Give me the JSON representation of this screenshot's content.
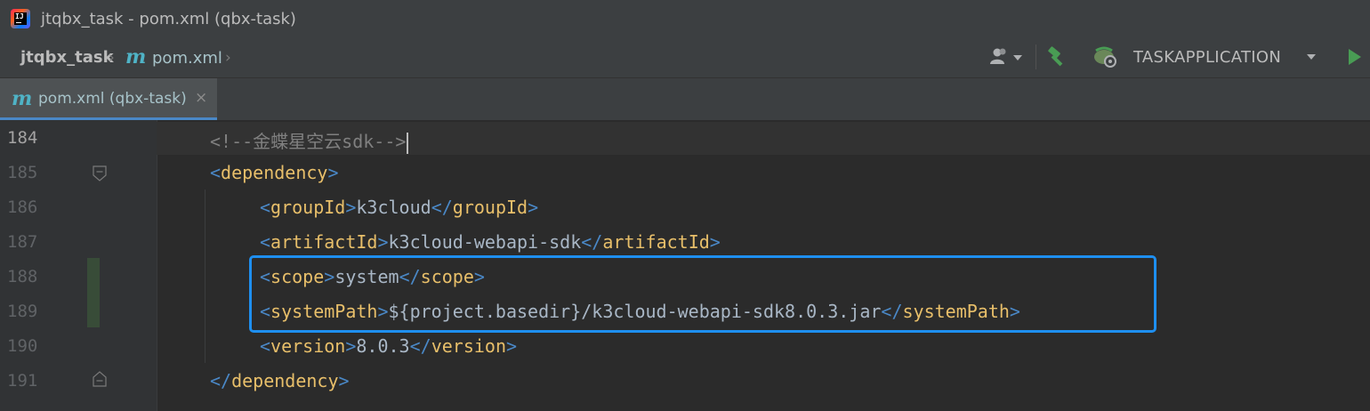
{
  "window": {
    "title": "jtqbx_task - pom.xml (qbx-task)",
    "app_icon_text": "IJ"
  },
  "navbar": {
    "project": "jtqbx_task",
    "file": "pom.xml",
    "run_configuration": "TASKAPPLICATION",
    "file_icon": "maven-m-icon"
  },
  "tab": {
    "label": "pom.xml (qbx-task)",
    "close": "×"
  },
  "editor": {
    "lines": [
      {
        "num": "184",
        "segments": [
          "<!--",
          "金蝶星空云sdk",
          "-->"
        ]
      },
      {
        "num": "185",
        "tag": "dependency",
        "kind": "open"
      },
      {
        "num": "186",
        "tag": "groupId",
        "value": "k3cloud"
      },
      {
        "num": "187",
        "tag": "artifactId",
        "value": "k3cloud-webapi-sdk"
      },
      {
        "num": "188",
        "tag": "scope",
        "value": "system"
      },
      {
        "num": "189",
        "tag": "systemPath",
        "value": "${project.basedir}/k3cloud-webapi-sdk8.0.3.jar"
      },
      {
        "num": "190",
        "tag": "version",
        "value": "8.0.3"
      },
      {
        "num": "191",
        "tag": "dependency",
        "kind": "close"
      }
    ]
  },
  "colors": {
    "tag": "#e8bf6a",
    "bracket": "#4a88c7",
    "text": "#a9b7c6",
    "comment": "#808080",
    "highlight_box": "#1e8ff0",
    "run_green": "#499c54"
  }
}
